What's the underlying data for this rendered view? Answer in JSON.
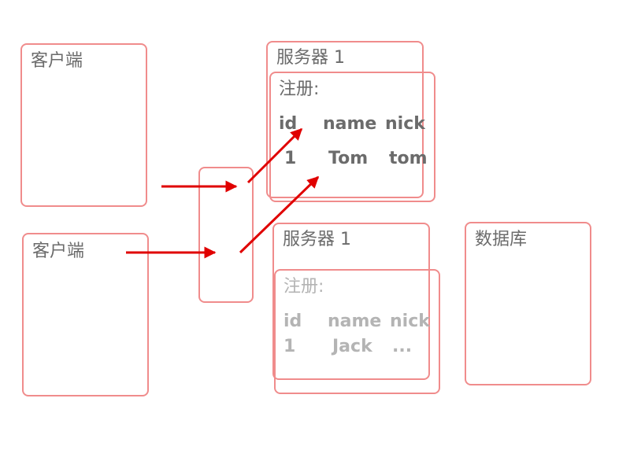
{
  "client_top": {
    "title": "客户端"
  },
  "client_bottom": {
    "title": "客户端"
  },
  "server_top": {
    "title": "服务器 1",
    "register_label": "注册:",
    "columns": [
      "id",
      "name",
      "nick"
    ],
    "row": [
      "1",
      "Tom",
      "tom"
    ]
  },
  "server_bottom": {
    "title": "服务器 1",
    "register_label": "注册:",
    "columns": [
      "id",
      "name",
      "nick"
    ],
    "row": [
      "1",
      "Jack",
      "..."
    ]
  },
  "database": {
    "title": "数据库"
  },
  "colors": {
    "box_border": "#f08c8c",
    "arrow": "#e00000",
    "text_dark": "#6b6b6b",
    "text_light": "#b4b4b4"
  }
}
